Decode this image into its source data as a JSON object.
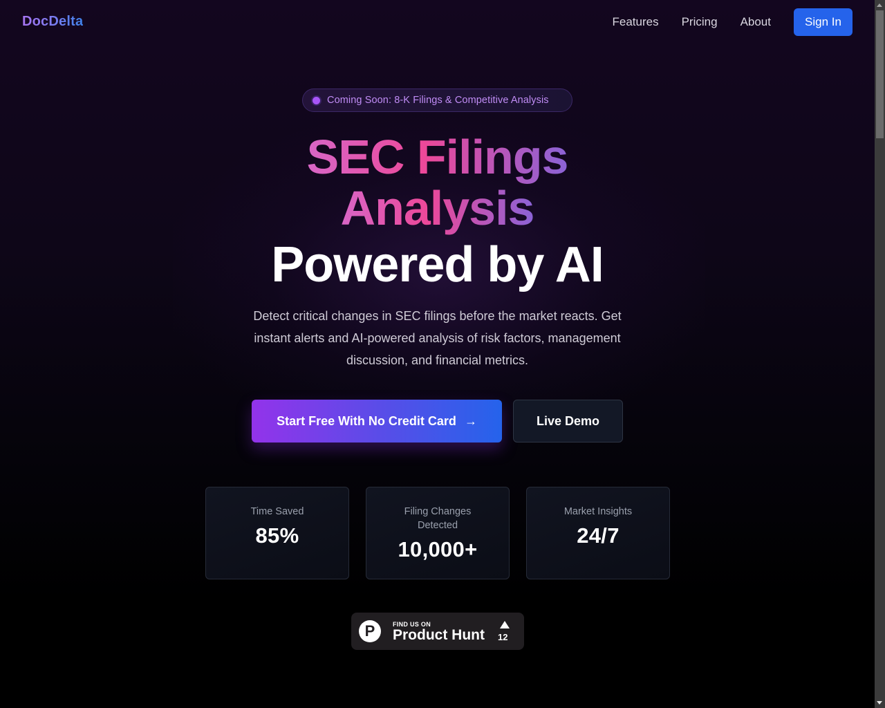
{
  "nav": {
    "logo": "DocDelta",
    "links": [
      "Features",
      "Pricing",
      "About"
    ],
    "signin_label": "Sign In"
  },
  "badge": {
    "text": "Coming Soon: 8-K Filings & Competitive Analysis"
  },
  "hero": {
    "title_line1": "SEC Filings",
    "title_line2": "Analysis",
    "title_line3": "Powered by AI",
    "subtitle": "Detect critical changes in SEC filings before the market reacts. Get instant alerts and AI-powered analysis of risk factors, management discussion, and financial metrics.",
    "cta_primary": "Start Free With No Credit Card",
    "cta_arrow": "→",
    "cta_secondary": "Live Demo"
  },
  "stats": [
    {
      "label": "Time Saved",
      "value": "85%"
    },
    {
      "label": "Filing Changes Detected",
      "value": "10,000+"
    },
    {
      "label": "Market Insights",
      "value": "24/7"
    }
  ],
  "product_hunt": {
    "logo_letter": "P",
    "small": "FIND US ON",
    "big": "Product Hunt",
    "upvotes": "12"
  },
  "colors": {
    "accent_blue": "#2563eb",
    "accent_purple": "#9333ea",
    "badge_text": "#c08cf5",
    "title_pink": "#ec4899"
  }
}
